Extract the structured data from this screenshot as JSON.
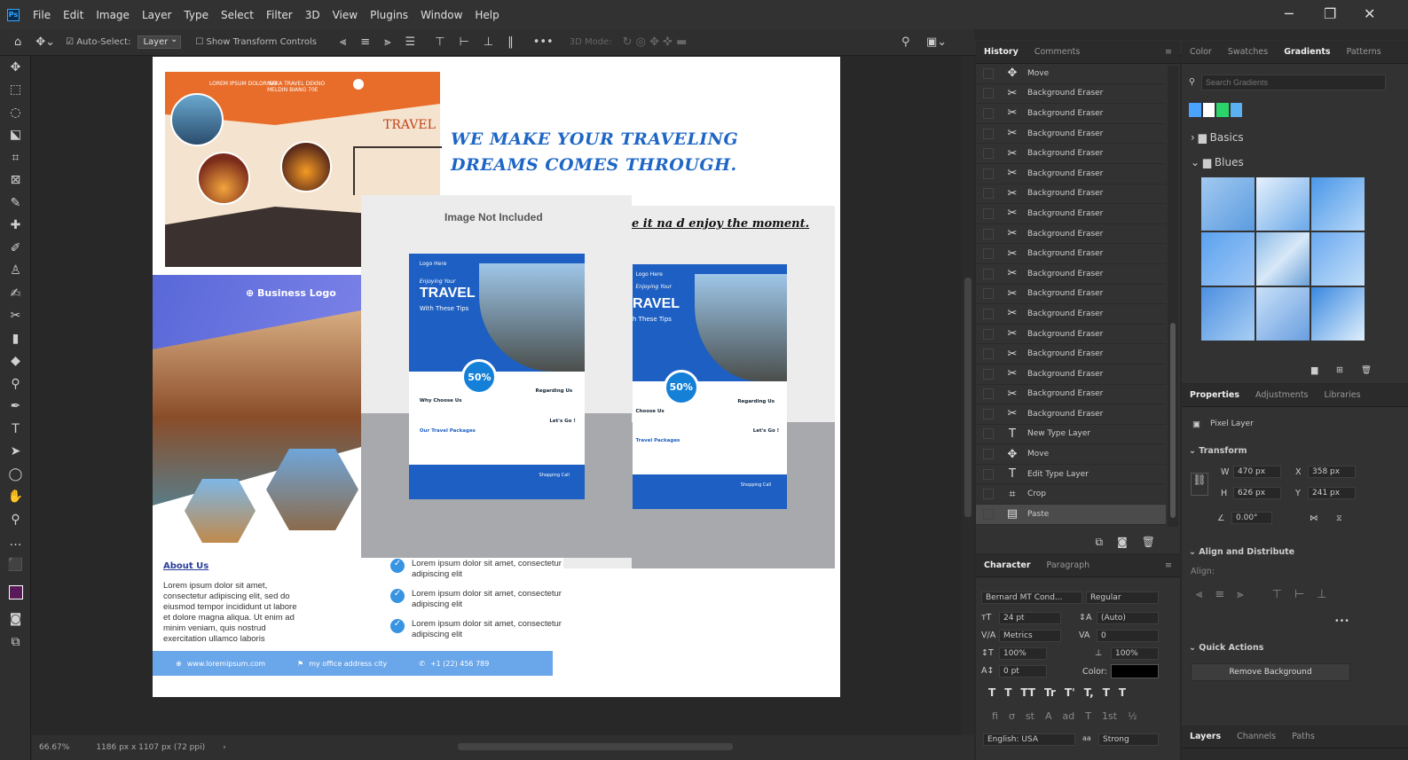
{
  "app": {
    "logo": "Ps"
  },
  "menu": [
    "File",
    "Edit",
    "Image",
    "Layer",
    "Type",
    "Select",
    "Filter",
    "3D",
    "View",
    "Plugins",
    "Window",
    "Help"
  ],
  "window_controls": {
    "minimize": "─",
    "restore": "❐",
    "close": "✕"
  },
  "options_bar": {
    "auto_select": "Auto-Select:",
    "layer_select": "Layer",
    "show_transform": "Show Transform Controls",
    "mode_3d": "3D Mode:"
  },
  "document": {
    "headline_line1": "WE MAKE YOUR TRAVELING",
    "headline_line2": "DREAMS COMES THROUGH.",
    "image_not_included": "Image Not Included",
    "tagline": "e it na d enjoy the moment.",
    "brochure_top_text1": "LOREM IPSUM DOLOR SIT",
    "brochure_top_text2": "MAKA TRAVEL DEKNO MELDIN BIANG 70E",
    "brochure_travel": "TRAVEL",
    "business_logo": "Business Logo",
    "about_title": "About Us",
    "about_text": "Lorem ipsum dolor sit amet, consectetur adipiscing elit, sed do eiusmod tempor incididunt ut labore et dolore magna aliqua. Ut enim ad minim veniam, quis nostrud exercitation ullamco laboris",
    "checklist": [
      "Lorem ipsum dolor sit amet, consectetur adipiscing elit",
      "Lorem ipsum dolor sit amet, consectetur adipiscing elit",
      "Lorem ipsum dolor sit amet, consectetur adipiscing elit"
    ],
    "footer_web": "www.loremipsum.com",
    "footer_address": "my office address city",
    "footer_phone": "+1 (22) 456 789",
    "flyer1": {
      "logo": "Logo Here",
      "script": "Enjoying Your",
      "title": "TRAVEL",
      "subtitle": "With These Tips",
      "badge": "50%",
      "why": "Why Choose Us",
      "packages": "Our Travel Packages",
      "regarding": "Regarding Us",
      "lets": "Let's Go !",
      "shopping": "Shopping Call"
    },
    "flyer2": {
      "logo": "Logo Here",
      "script": "Enjoying Your",
      "title": "RAVEL",
      "subtitle": "h These Tips",
      "badge": "50%",
      "why": "Choose Us",
      "packages": "Travel Packages",
      "regarding": "Regarding Us",
      "lets": "Let's Go !",
      "shopping": "Shopping Call"
    }
  },
  "status": {
    "zoom": "66.67%",
    "doc_info": "1186 px x 1107 px (72 ppi)"
  },
  "history": {
    "tabs": [
      "History",
      "Comments"
    ],
    "items": [
      {
        "icon": "✥",
        "label": "Move"
      },
      {
        "icon": "✂",
        "label": "Background Eraser"
      },
      {
        "icon": "✂",
        "label": "Background Eraser"
      },
      {
        "icon": "✂",
        "label": "Background Eraser"
      },
      {
        "icon": "✂",
        "label": "Background Eraser"
      },
      {
        "icon": "✂",
        "label": "Background Eraser"
      },
      {
        "icon": "✂",
        "label": "Background Eraser"
      },
      {
        "icon": "✂",
        "label": "Background Eraser"
      },
      {
        "icon": "✂",
        "label": "Background Eraser"
      },
      {
        "icon": "✂",
        "label": "Background Eraser"
      },
      {
        "icon": "✂",
        "label": "Background Eraser"
      },
      {
        "icon": "✂",
        "label": "Background Eraser"
      },
      {
        "icon": "✂",
        "label": "Background Eraser"
      },
      {
        "icon": "✂",
        "label": "Background Eraser"
      },
      {
        "icon": "✂",
        "label": "Background Eraser"
      },
      {
        "icon": "✂",
        "label": "Background Eraser"
      },
      {
        "icon": "✂",
        "label": "Background Eraser"
      },
      {
        "icon": "✂",
        "label": "Background Eraser"
      },
      {
        "icon": "T",
        "label": "New Type Layer"
      },
      {
        "icon": "✥",
        "label": "Move"
      },
      {
        "icon": "T",
        "label": "Edit Type Layer"
      },
      {
        "icon": "⌗",
        "label": "Crop"
      },
      {
        "icon": "▤",
        "label": "Paste"
      }
    ]
  },
  "character": {
    "tabs": [
      "Character",
      "Paragraph"
    ],
    "font": "Bernard MT Cond...",
    "style": "Regular",
    "size": "24 pt",
    "leading": "(Auto)",
    "kerning": "Metrics",
    "tracking": "0",
    "vscale": "100%",
    "hscale": "100%",
    "baseline": "0 pt",
    "color_label": "Color:",
    "language": "English: USA",
    "aa_label": "aa",
    "antialias": "Strong",
    "type_buttons": [
      "T",
      "T",
      "TT",
      "Tr",
      "T'",
      "T,",
      "T",
      "T"
    ],
    "ot_buttons": [
      "fi",
      "σ",
      "st",
      "A",
      "ad",
      "T",
      "1st",
      "½"
    ]
  },
  "gradients": {
    "tabs": [
      "Color",
      "Swatches",
      "Gradients",
      "Patterns"
    ],
    "search_placeholder": "Search Gradients",
    "groups": [
      "Basics",
      "Blues"
    ]
  },
  "properties": {
    "tabs": [
      "Properties",
      "Adjustments",
      "Libraries"
    ],
    "layer_type": "Pixel Layer",
    "transform_title": "Transform",
    "w_label": "W",
    "w": "470 px",
    "x_label": "X",
    "x": "358 px",
    "h_label": "H",
    "h": "626 px",
    "y_label": "Y",
    "y": "241 px",
    "angle": "0.00°",
    "align_title": "Align and Distribute",
    "align_label": "Align:",
    "quick_title": "Quick Actions",
    "remove_bg": "Remove Background"
  },
  "layers_tabs": [
    "Layers",
    "Channels",
    "Paths"
  ]
}
